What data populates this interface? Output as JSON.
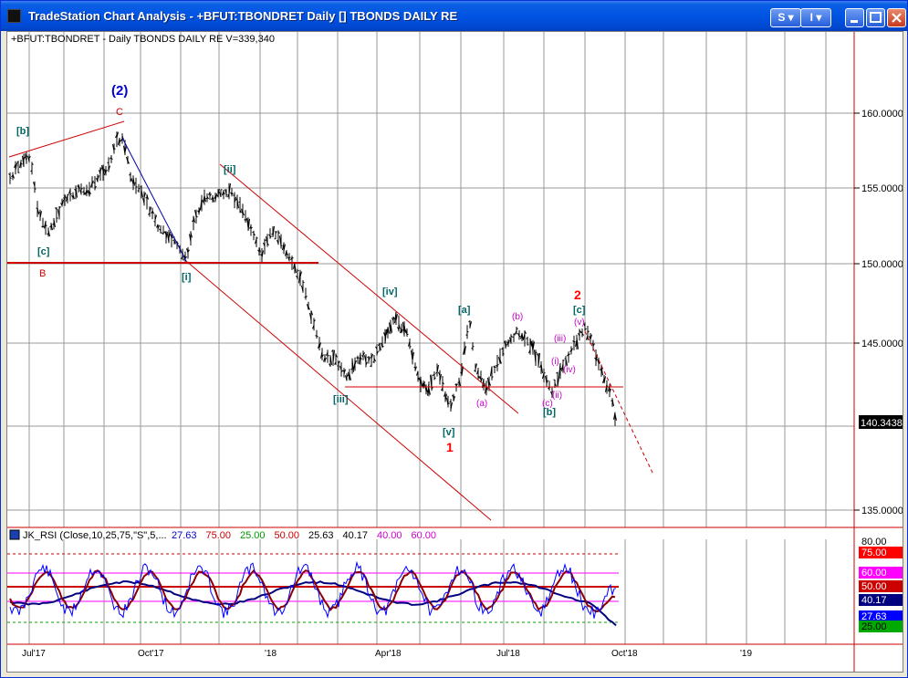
{
  "window": {
    "title": "TradeStation Chart Analysis - +BFUT:TBONDRET Daily [] TBONDS DAILY RE",
    "btn_s": "S",
    "btn_i": "I"
  },
  "chart": {
    "header": "+BFUT:TBONDRET - Daily  TBONDS DAILY RE  V=339,340",
    "last_price": "140.3438",
    "price_ticks": [
      "160.0000",
      "155.0000",
      "150.0000",
      "145.0000",
      "135.0000"
    ],
    "date_ticks": [
      "Jul'17",
      "Oct'17",
      "'18",
      "Apr'18",
      "Jul'18",
      "Oct'18",
      "'19"
    ]
  },
  "rsi": {
    "header_name": "JK_RSI (Close,10,25,75,\"S\",5,...",
    "header_values": [
      {
        "text": "27.63",
        "color": "#0000cc"
      },
      {
        "text": "75.00",
        "color": "#cc0000"
      },
      {
        "text": "25.00",
        "color": "#009900"
      },
      {
        "text": "50.00",
        "color": "#cc0000"
      },
      {
        "text": "25.63",
        "color": "#000000"
      },
      {
        "text": "40.17",
        "color": "#000000"
      },
      {
        "text": "40.00",
        "color": "#cc00cc"
      },
      {
        "text": "60.00",
        "color": "#cc00cc"
      }
    ],
    "axis_labels": [
      {
        "text": "80.00",
        "bg": "#ffffff",
        "fg": "#000000"
      },
      {
        "text": "75.00",
        "bg": "#ff0000",
        "fg": "#ffffff"
      },
      {
        "text": "60.00",
        "bg": "#ff00ff",
        "fg": "#ffffff"
      },
      {
        "text": "50.00",
        "bg": "#cc0000",
        "fg": "#ffffff"
      },
      {
        "text": "40.17",
        "bg": "#000080",
        "fg": "#ffffff"
      },
      {
        "text": "27.63",
        "bg": "#0000ff",
        "fg": "#ffffff"
      },
      {
        "text": "25.00",
        "bg": "#00aa00",
        "fg": "#000000"
      }
    ]
  },
  "wave_labels": [
    {
      "id": "w2-primary",
      "text": "(2)",
      "color": "#0000cc"
    },
    {
      "id": "c-top",
      "text": "C",
      "color": "#cc0000"
    },
    {
      "id": "b-top",
      "text": "[b]",
      "color": "#006666"
    },
    {
      "id": "c-low",
      "text": "[c]",
      "color": "#006666"
    },
    {
      "id": "B",
      "text": "B",
      "color": "#cc0000"
    },
    {
      "id": "ii",
      "text": "[ii]",
      "color": "#006666"
    },
    {
      "id": "i",
      "text": "[i]",
      "color": "#006666"
    },
    {
      "id": "iv",
      "text": "[iv]",
      "color": "#006666"
    },
    {
      "id": "iii",
      "text": "[iii]",
      "color": "#006666"
    },
    {
      "id": "v",
      "text": "[v]",
      "color": "#006666"
    },
    {
      "id": "one",
      "text": "1",
      "color": "#ff0000"
    },
    {
      "id": "a-top",
      "text": "[a]",
      "color": "#006666"
    },
    {
      "id": "a-small",
      "text": "(a)",
      "color": "#cc00cc"
    },
    {
      "id": "b-small",
      "text": "(b)",
      "color": "#cc00cc"
    },
    {
      "id": "c-small",
      "text": "(c)",
      "color": "#cc00cc"
    },
    {
      "id": "b-bracket",
      "text": "[b]",
      "color": "#006666"
    },
    {
      "id": "i-small",
      "text": "(i)",
      "color": "#cc00cc"
    },
    {
      "id": "ii-small",
      "text": "(ii)",
      "color": "#cc00cc"
    },
    {
      "id": "iii-small",
      "text": "(iii)",
      "color": "#cc00cc"
    },
    {
      "id": "iv-small",
      "text": "(iv)",
      "color": "#cc00cc"
    },
    {
      "id": "v-small",
      "text": "(v)",
      "color": "#cc00cc"
    },
    {
      "id": "c-bracket",
      "text": "[c]",
      "color": "#006666"
    },
    {
      "id": "two",
      "text": "2",
      "color": "#ff0000"
    }
  ]
}
